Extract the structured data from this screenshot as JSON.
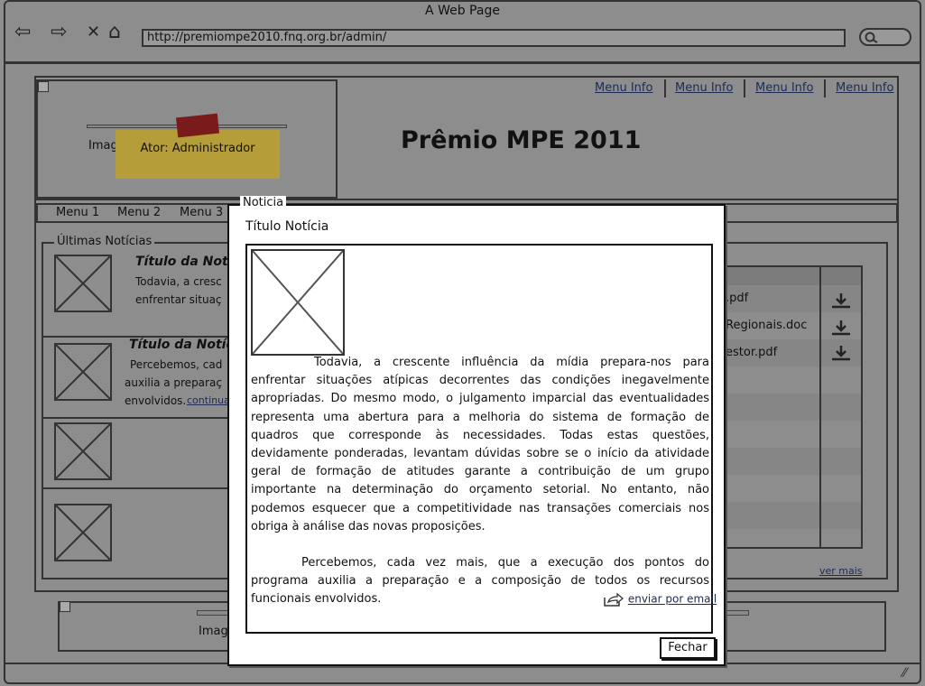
{
  "browser": {
    "window_title": "A Web Page",
    "url": "http://premiompe2010.fnq.org.br/admin/",
    "back_glyph": "⇦",
    "forward_glyph": "⇨",
    "stop_glyph": "✕",
    "home_glyph": "⌂"
  },
  "header": {
    "logo_label": "Imag",
    "postit_text": "Ator: Administrador",
    "title": "Prêmio MPE 2011",
    "menu_info": [
      "Menu Info",
      "Menu Info",
      "Menu Info",
      "Menu Info"
    ]
  },
  "menu": {
    "items": [
      "Menu 1",
      "Menu 2",
      "Menu 3"
    ]
  },
  "news": {
    "legend": "Últimas Notícias",
    "items": [
      {
        "title": "Título da Notíc",
        "line1": "Todavia, a cresc",
        "line2": "enfrentar situaç"
      },
      {
        "title": "Título da Notíci",
        "line1": "Percebemos, cad",
        "line2": "auxilia a preparaç",
        "line3": "envolvidos.",
        "more": "continua..."
      }
    ]
  },
  "downloads": {
    "files": [
      ".pdf",
      "Regionais.doc",
      "estor.pdf"
    ],
    "icon": "download-icon",
    "see_more": "ver mais"
  },
  "footer": {
    "logo_label": "Image"
  },
  "modal": {
    "legend": "Noticia",
    "title": "Título Notícia",
    "paragraph1": "Todavia, a crescente influência da mídia prepara-nos para enfrentar situações atípicas decorrentes das condições inegavelmente apropriadas. Do mesmo modo, o julgamento imparcial das eventualidades representa uma abertura para a melhoria do sistema de formação de quadros que corresponde às necessidades. Todas estas questões, devidamente ponderadas, levantam dúvidas sobre se o início da atividade geral de formação de atitudes garante a contribuição de um grupo importante na determinação do orçamento setorial. No entanto, não podemos esquecer que a competitividade nas transações comerciais nos obriga à análise das novas proposições.",
    "paragraph2": "Percebemos, cada vez mais, que a execução dos pontos do programa auxilia a preparação e a composição de todos os recursos funcionais envolvidos.",
    "email_link": "enviar por email",
    "close_button": "Fechar"
  }
}
